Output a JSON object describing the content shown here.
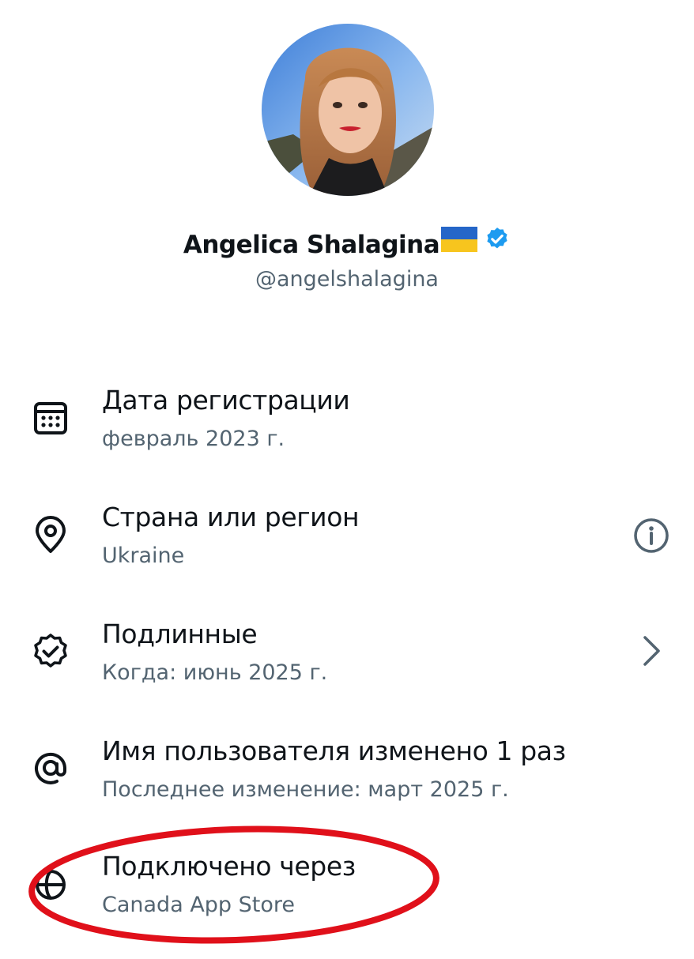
{
  "profile": {
    "display_name": "Angelica Shalagina",
    "flag": "ukraine-flag-emoji",
    "verified": true,
    "handle": "@angelshalagina"
  },
  "details": [
    {
      "icon": "calendar-icon",
      "title": "Дата регистрации",
      "subtitle": "февраль 2023 г."
    },
    {
      "icon": "location-pin-icon",
      "title": "Страна или регион",
      "subtitle": "Ukraine",
      "action": "info-icon"
    },
    {
      "icon": "verified-check-icon",
      "title": "Подлинные",
      "subtitle": "Когда: июнь 2025 г.",
      "action": "chevron-right-icon"
    },
    {
      "icon": "at-sign-icon",
      "title": "Имя пользователя изменено 1 раз",
      "subtitle": "Последнее изменение: март 2025 г."
    },
    {
      "icon": "globe-icon",
      "title": "Подключено через",
      "subtitle": "Canada App Store"
    }
  ],
  "colors": {
    "text_primary": "#0f1419",
    "text_secondary": "#536471",
    "verified_blue": "#1d9bf0",
    "highlight_red": "#e0101a"
  }
}
